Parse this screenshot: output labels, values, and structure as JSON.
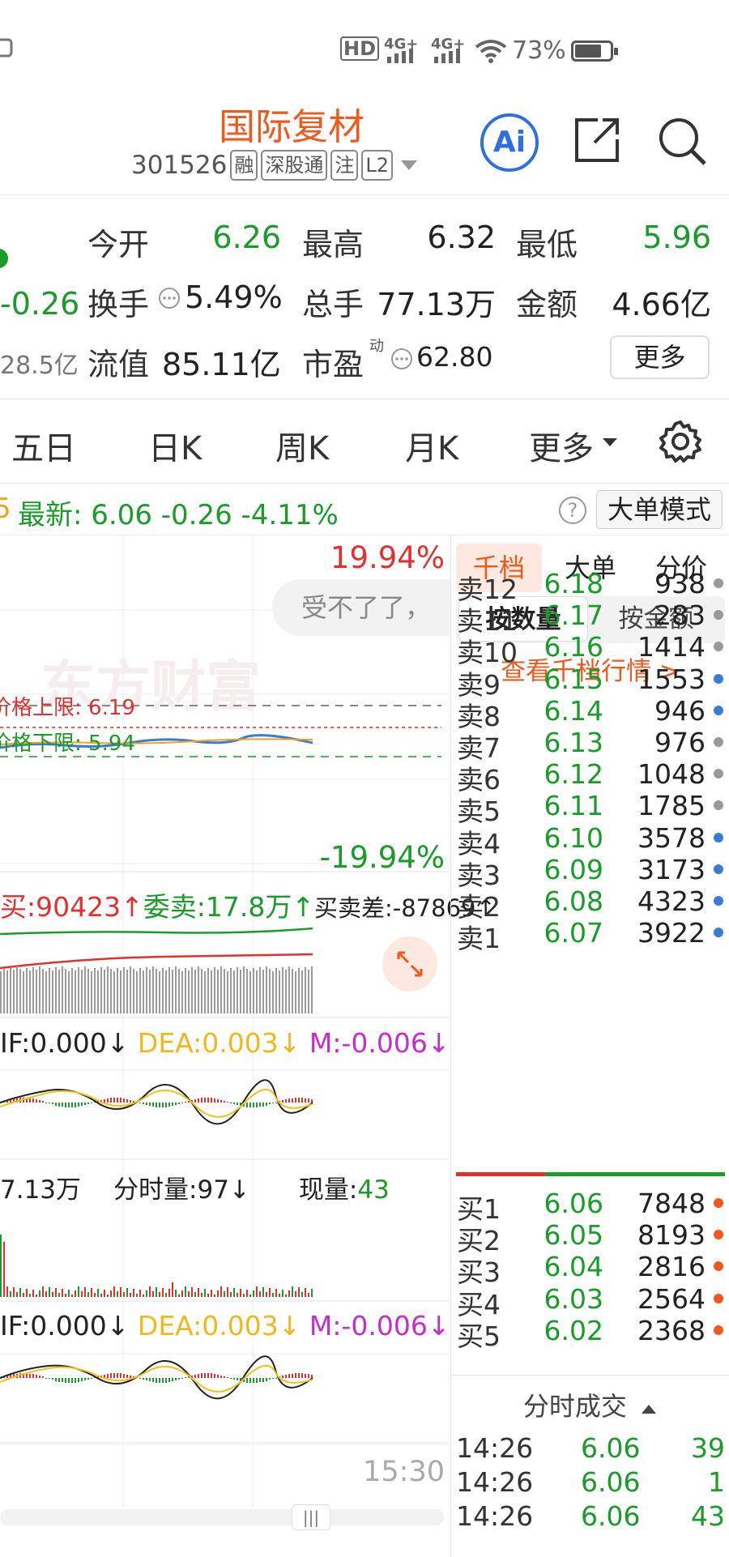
{
  "status_bar": {
    "hd": "HD",
    "sig1": "4G+",
    "sig2": "4G+",
    "battery_pct": "73%",
    "battery_level": 0.73
  },
  "header": {
    "name": "国际复材",
    "code": "301526",
    "tags": [
      "融",
      "深股通",
      "注",
      "L2"
    ],
    "ai_label": "Ai"
  },
  "quote": {
    "change": "-0.26",
    "mktcap": "28.5亿",
    "open_label": "今开",
    "open": "6.26",
    "high_label": "最高",
    "high": "6.32",
    "low_label": "最低",
    "low": "5.96",
    "turnover_label": "换手",
    "turnover": "5.49%",
    "volume_label": "总手",
    "volume": "77.13万",
    "amount_label": "金额",
    "amount": "4.66亿",
    "float_label": "流值",
    "float_val": "85.11亿",
    "pe_label": "市盈",
    "pe_sup": "动",
    "pe": "62.80",
    "more_label": "更多"
  },
  "tabs": [
    "五日",
    "日K",
    "周K",
    "月K",
    "更多"
  ],
  "latest": {
    "prefix": "5",
    "text": "最新:  6.06   -0.26   -4.11%",
    "help": "?",
    "mode_btn": "大单模式"
  },
  "chart": {
    "upper_pct": "19.94%",
    "lower_pct": "-19.94%",
    "bubble": "受不了了，",
    "upper_limit": "价格上限: 6.19",
    "lower_limit": "价格下限: 5.94",
    "watermark": "东方财富",
    "order_line": {
      "buy": "买:90423↑",
      "sell": "委卖:17.8万↑",
      "diff": "买卖差:-87869↑"
    },
    "macd1": {
      "dif": "IF:0.000↓",
      "dea": "DEA:0.003↓",
      "m": "M:-0.006↓"
    },
    "vol_line": {
      "total": "7.13万",
      "period": "分时量:97↓",
      "now_label": "现量:",
      "now": "43"
    },
    "macd2": {
      "dif": "IF:0.000↓",
      "dea": "DEA:0.003↓",
      "m": "M:-0.006↓"
    },
    "end_time": "15:30",
    "scroll_handle": "|||"
  },
  "right_panel": {
    "tabs": [
      "千档",
      "大单",
      "分价"
    ],
    "segments": [
      "按数量",
      "按金额"
    ],
    "link": "查看千档行情 >",
    "asks": [
      {
        "label": "卖12",
        "price": "6.18",
        "vol": "938",
        "dot": "#999999"
      },
      {
        "label": "卖11",
        "price": "6.17",
        "vol": "283",
        "dot": "#999999"
      },
      {
        "label": "卖10",
        "price": "6.16",
        "vol": "1414",
        "dot": "#999999"
      },
      {
        "label": "卖9",
        "price": "6.15",
        "vol": "1553",
        "dot": "#3a7bd5"
      },
      {
        "label": "卖8",
        "price": "6.14",
        "vol": "946",
        "dot": "#3a7bd5"
      },
      {
        "label": "卖7",
        "price": "6.13",
        "vol": "976",
        "dot": "#999999"
      },
      {
        "label": "卖6",
        "price": "6.12",
        "vol": "1048",
        "dot": "#999999"
      },
      {
        "label": "卖5",
        "price": "6.11",
        "vol": "1785",
        "dot": "#999999"
      },
      {
        "label": "卖4",
        "price": "6.10",
        "vol": "3578",
        "dot": "#3a7bd5"
      },
      {
        "label": "卖3",
        "price": "6.09",
        "vol": "3173",
        "dot": "#3a7bd5"
      },
      {
        "label": "卖2",
        "price": "6.08",
        "vol": "4323",
        "dot": "#3a7bd5"
      },
      {
        "label": "卖1",
        "price": "6.07",
        "vol": "3922",
        "dot": "#3a7bd5"
      }
    ],
    "bids": [
      {
        "label": "买1",
        "price": "6.06",
        "vol": "7848",
        "dot": "#f0591c"
      },
      {
        "label": "买2",
        "price": "6.05",
        "vol": "8193",
        "dot": "#f0591c"
      },
      {
        "label": "买3",
        "price": "6.04",
        "vol": "2816",
        "dot": "#f0591c"
      },
      {
        "label": "买4",
        "price": "6.03",
        "vol": "2564",
        "dot": "#f0591c"
      },
      {
        "label": "买5",
        "price": "6.02",
        "vol": "2368",
        "dot": "#f0591c"
      }
    ],
    "trades_title": "分时成交",
    "trades": [
      {
        "time": "14:26",
        "price": "6.06",
        "vol": "39"
      },
      {
        "time": "14:26",
        "price": "6.06",
        "vol": "1"
      },
      {
        "time": "14:26",
        "price": "6.06",
        "vol": "43"
      }
    ]
  },
  "colors": {
    "accent": "#f0591c",
    "up": "#e0312f",
    "down": "#1a9b2a",
    "ai": "#2f6fe0"
  }
}
